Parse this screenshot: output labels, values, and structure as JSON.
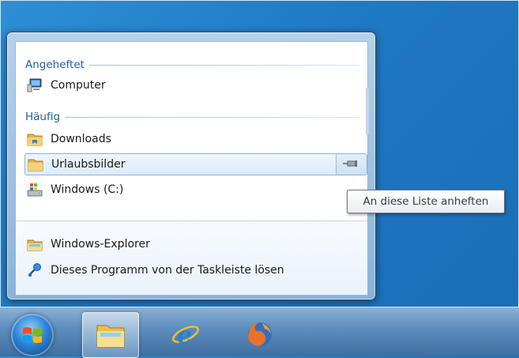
{
  "jumplist": {
    "pinned_header": "Angeheftet",
    "frequent_header": "Häufig",
    "pinned": [
      {
        "label": "Computer",
        "icon": "computer-icon"
      }
    ],
    "frequent": [
      {
        "label": "Downloads",
        "icon": "folder-icon"
      },
      {
        "label": "Urlaubsbilder",
        "icon": "folder-icon",
        "highlighted": true
      },
      {
        "label": "Windows (C:)",
        "icon": "drive-icon"
      }
    ],
    "tasks": [
      {
        "label": "Windows-Explorer",
        "icon": "explorer-icon"
      },
      {
        "label": "Dieses Programm von der Taskleiste lösen",
        "icon": "unpin-icon"
      }
    ]
  },
  "tooltip": {
    "text": "An diese Liste anheften"
  },
  "taskbar": {
    "items": [
      {
        "name": "start-button",
        "icon": "windows-orb-icon"
      },
      {
        "name": "explorer",
        "icon": "explorer-folder-icon",
        "active": true
      },
      {
        "name": "internet-explorer",
        "icon": "internet-explorer-icon"
      },
      {
        "name": "firefox",
        "icon": "firefox-icon"
      }
    ]
  },
  "colors": {
    "accent": "#1e5fa8",
    "desktop": "#1f78c4"
  }
}
